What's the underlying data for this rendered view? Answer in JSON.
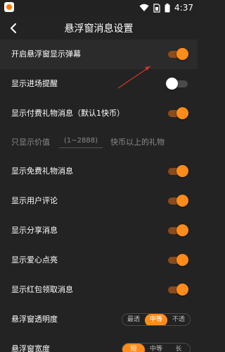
{
  "status_bar": {
    "time": "4:37",
    "icons": [
      "app-icon",
      "wifi-icon",
      "sim-icon",
      "battery-icon"
    ]
  },
  "header": {
    "title": "悬浮窗消息设置",
    "back_icon": "chevron-left-icon"
  },
  "settings": {
    "toggles": [
      {
        "label": "开启悬浮窗显示弹幕",
        "on": true
      },
      {
        "label": "显示进场提醒",
        "on": false
      },
      {
        "label": "显示付费礼物消息（默认1快币）",
        "on": true
      },
      {
        "label": "显示免费礼物消息",
        "on": true
      },
      {
        "label": "显示用户评论",
        "on": true
      },
      {
        "label": "显示分享消息",
        "on": true
      },
      {
        "label": "显示爱心点亮",
        "on": true
      },
      {
        "label": "显示红包领取消息",
        "on": true
      }
    ],
    "value_filter": {
      "prefix": "只显示价值",
      "placeholder": "(1~2888)",
      "suffix": "快币以上的礼物"
    },
    "opacity": {
      "label": "悬浮窗透明度",
      "options": [
        "最透",
        "中等",
        "不透"
      ],
      "selected": "中等"
    },
    "width": {
      "label": "悬浮窗宽度",
      "options": [
        "短",
        "中等",
        "长"
      ],
      "selected": "短"
    }
  },
  "colors": {
    "accent": "#ff8c1a",
    "background": "#232323",
    "annotation_arrow": "#d0352b"
  }
}
